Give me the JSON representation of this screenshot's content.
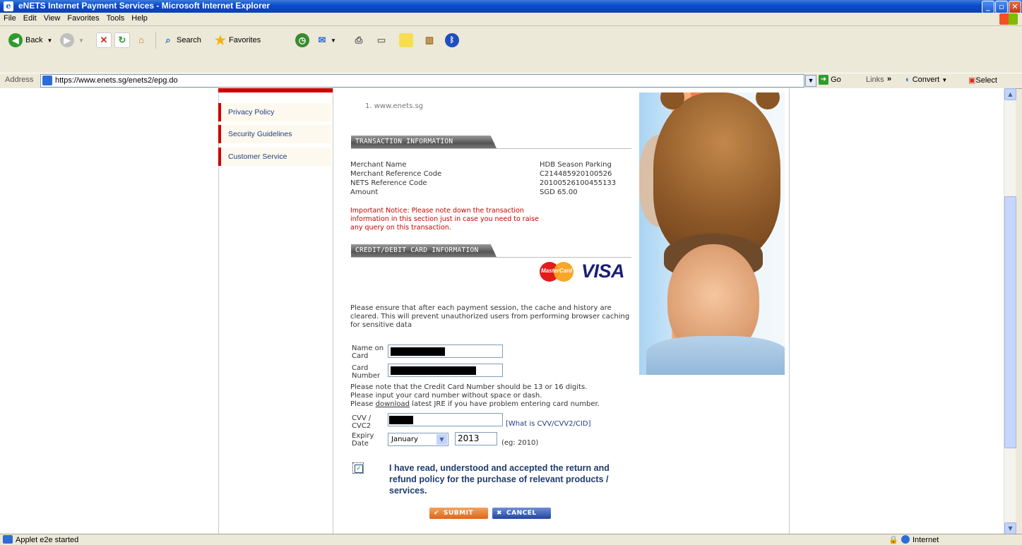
{
  "window": {
    "title": "eNETS Internet Payment Services - Microsoft Internet Explorer",
    "buttons": {
      "minimize": "_",
      "maximize": "▫",
      "close": "✕"
    }
  },
  "menu": [
    "File",
    "Edit",
    "View",
    "Favorites",
    "Tools",
    "Help"
  ],
  "toolbar": {
    "back": "Back",
    "search": "Search",
    "favorites": "Favorites"
  },
  "address": {
    "label": "Address",
    "url": "https://www.enets.sg/enets2/epg.do",
    "go": "Go",
    "links": "Links",
    "convert": "Convert",
    "select": "Select"
  },
  "sidebar": {
    "items": [
      {
        "label": "Privacy Policy"
      },
      {
        "label": "Security Guidelines"
      },
      {
        "label": "Customer Service"
      }
    ]
  },
  "content": {
    "footnote": "1.  www.enets.sg",
    "transaction_header": "TRANSACTION INFORMATION",
    "transaction": {
      "labels": [
        "Merchant Name",
        "Merchant Reference Code",
        "NETS Reference Code",
        "Amount"
      ],
      "values": [
        "HDB Season Parking",
        "C214485920100526",
        "20100526100455133",
        "SGD 65.00"
      ]
    },
    "notice": "Important Notice: Please note down the transaction information in this section just in case you need to raise any query on this transaction.",
    "card_header": "CREDIT/DEBIT CARD INFORMATION",
    "mastercard": "MasterCard",
    "visa": "VISA",
    "cache_notice": "Please ensure that after each payment session, the cache and history are cleared. This will prevent unauthorized users from performing browser caching for sensitive data",
    "name_label_1": "Name on",
    "name_label_2": "Card",
    "number_label_1": "Card",
    "number_label_2": "Number",
    "note1": "Please note that the Credit Card Number should be 13 or 16 digits.",
    "note2": "Please input your card number without space or dash.",
    "note3_pre": "Please ",
    "note3_link": "download",
    "note3_post": " latest JRE if you have problem entering card number.",
    "cvv_label_1": "CVV /",
    "cvv_label_2": "CVC2",
    "cvv_link": "[What is CVV/CVV2/CID]",
    "expiry_label_1": "Expiry",
    "expiry_label_2": "Date",
    "expiry_month": "January",
    "expiry_year": "2013",
    "expiry_hint": "(eg: 2010)",
    "accept_text": "I have read, understood and accepted the return and refund policy for the purchase of relevant products / services.",
    "accept_checked": true,
    "submit": "SUBMIT",
    "cancel": "CANCEL"
  },
  "status": {
    "text": "Applet e2e started",
    "zone": "Internet"
  }
}
